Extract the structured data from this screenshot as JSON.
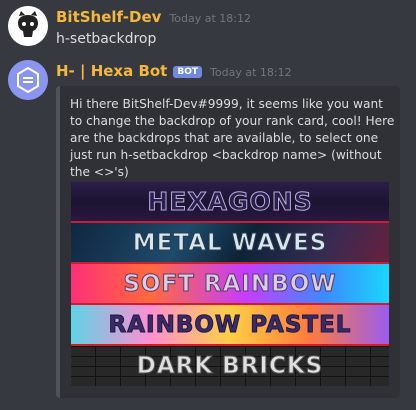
{
  "message1": {
    "username": "BitShelf-Dev",
    "timestamp": "Today at 18:12",
    "text": "h-setbackdrop"
  },
  "message2": {
    "username": "H- | Hexa Bot",
    "bot_tag": "BOT",
    "timestamp": "Today at 18:12",
    "embed": {
      "description": "Hi there BitShelf-Dev#9999, it seems like you want to change the backdrop of your rank card, cool! Here are the backdrops that are available, to select one just run h-setbackdrop <backdrop name> (without the <>'s)",
      "backdrops": [
        "HEXAGONS",
        "METAL WAVES",
        "SOFT RAINBOW",
        "RAINBOW PASTEL",
        "DARK BRICKS"
      ]
    }
  },
  "colors": {
    "background": "#36393f",
    "embed_bg": "#2f3136",
    "username": "#f6b83c",
    "bot_tag": "#7289da"
  }
}
